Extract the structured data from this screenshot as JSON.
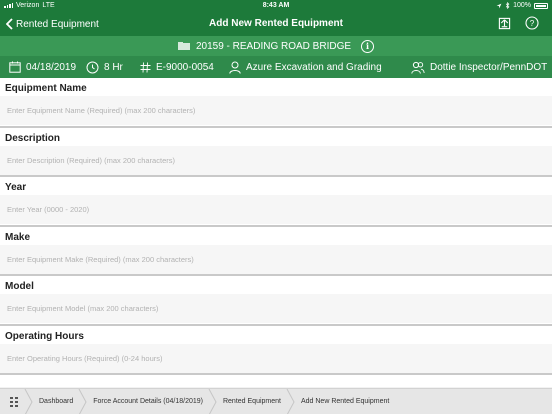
{
  "status_bar": {
    "carrier": "Verizon",
    "network": "LTE",
    "time": "8:43 AM",
    "battery": "100%"
  },
  "nav": {
    "back_label": "Rented Equipment",
    "title": "Add New Rented Equipment"
  },
  "project": {
    "label": "20159 - READING ROAD BRIDGE"
  },
  "info": {
    "date": "04/18/2019",
    "hours": "8 Hr",
    "equipment_no": "E-9000-0054",
    "contractor": "Azure Excavation and Grading",
    "inspector": "Dottie Inspector/PennDOT"
  },
  "fields": [
    {
      "label": "Equipment Name",
      "placeholder": "Enter Equipment Name (Required) (max 200 characters)",
      "value": ""
    },
    {
      "label": "Description",
      "placeholder": "Enter Description (Required) (max 200 characters)",
      "value": ""
    },
    {
      "label": "Year",
      "placeholder": "Enter Year (0000 - 2020)",
      "value": ""
    },
    {
      "label": "Make",
      "placeholder": "Enter Equipment Make (Required) (max 200 characters)",
      "value": ""
    },
    {
      "label": "Model",
      "placeholder": "Enter Equipment Model (max 200 characters)",
      "value": ""
    },
    {
      "label": "Operating Hours",
      "placeholder": "Enter Operating Hours (Required) (0-24 hours)",
      "value": ""
    }
  ],
  "breadcrumb": [
    {
      "label": "Dashboard"
    },
    {
      "label": "Force Account Details (04/18/2019)"
    },
    {
      "label": "Rented Equipment"
    },
    {
      "label": "Add New Rented Equipment"
    }
  ],
  "colors": {
    "nav_green": "#1d7a3a",
    "project_green": "#3a9956",
    "info_green": "#2f8a4b"
  },
  "icons": {
    "back": "chevron-left-icon",
    "home": "home-upload-icon",
    "help": "question-circle-icon",
    "project": "folder-icon",
    "info": "info-circle-icon",
    "date": "calendar-icon",
    "hours": "clock-icon",
    "equipment_no": "hash-icon",
    "contractor": "person-icon",
    "inspector": "people-icon",
    "menu": "grid-icon"
  }
}
